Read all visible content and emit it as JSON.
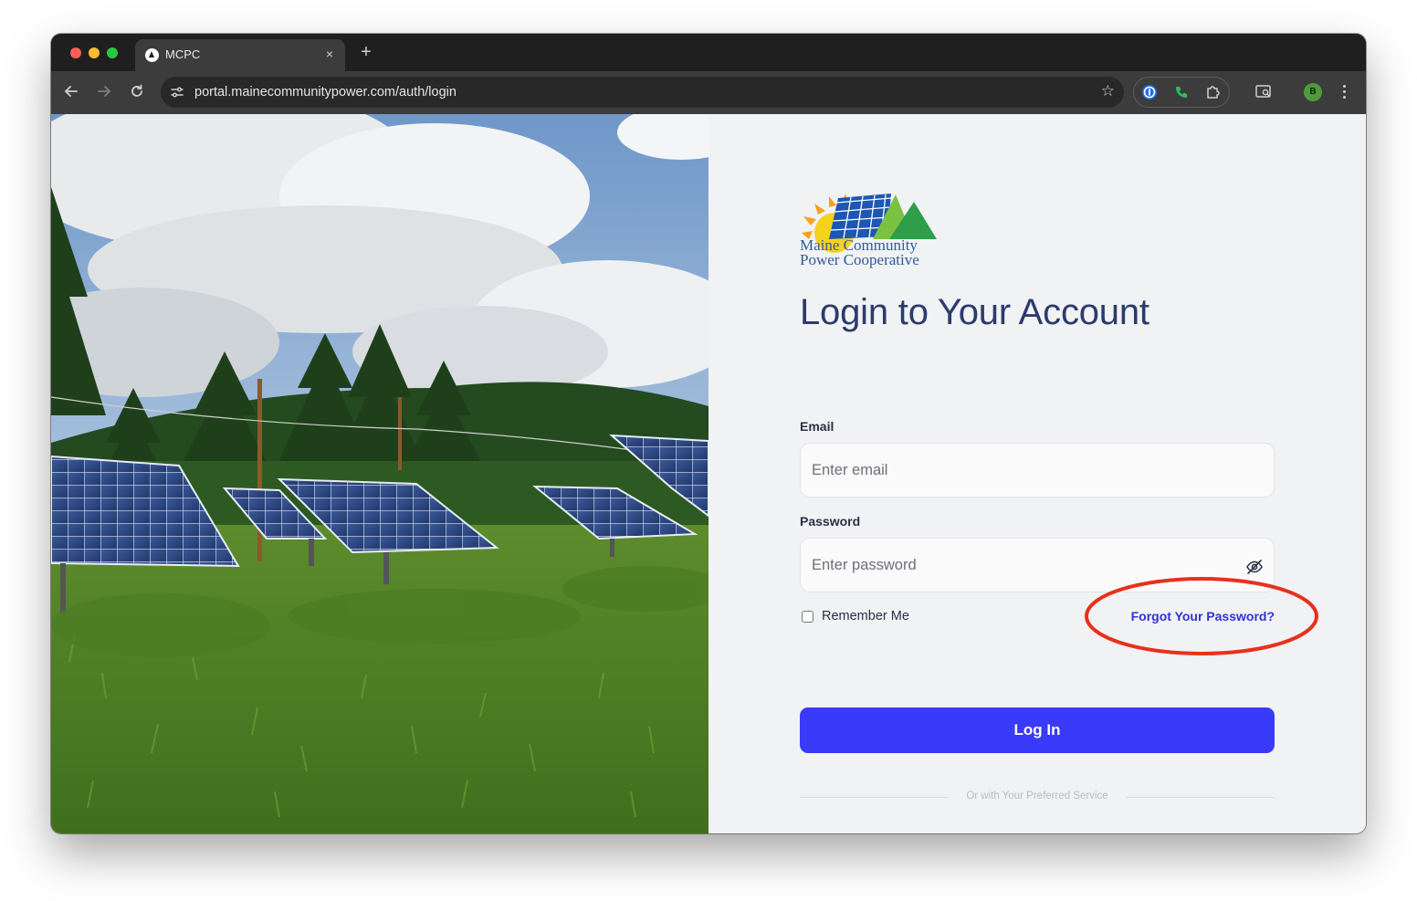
{
  "browser": {
    "tab_title": "MCPC",
    "tab_close": "×",
    "new_tab": "+",
    "url": "portal.mainecommunitypower.com/auth/login",
    "profile_initial": "B"
  },
  "logo": {
    "line1": "Maine Community",
    "line2": "Power Cooperative"
  },
  "login": {
    "heading": "Login to Your Account",
    "email_label": "Email",
    "email_placeholder": "Enter email",
    "password_label": "Password",
    "password_placeholder": "Enter password",
    "remember_label": "Remember Me",
    "forgot_label": "Forgot Your Password?",
    "login_button": "Log In",
    "divider_text": "Or with Your Preferred Service"
  },
  "colors": {
    "accent": "#3a3afa",
    "heading": "#2b3b6d",
    "link": "#3531d8",
    "annotation": "#e8301c"
  }
}
